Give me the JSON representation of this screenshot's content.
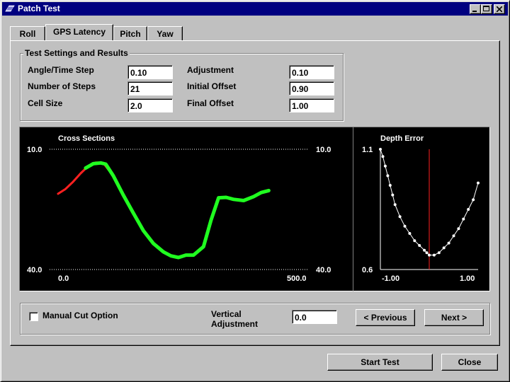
{
  "window": {
    "title": "Patch Test"
  },
  "tabs": [
    {
      "label": "Roll"
    },
    {
      "label": "GPS Latency"
    },
    {
      "label": "Pitch"
    },
    {
      "label": "Yaw"
    }
  ],
  "active_tab": "GPS Latency",
  "settings": {
    "group_title": "Test Settings and Results",
    "angle_time_step": {
      "label": "Angle/Time Step",
      "value": "0.10"
    },
    "number_of_steps": {
      "label": "Number of Steps",
      "value": "21"
    },
    "cell_size": {
      "label": "Cell Size",
      "value": "2.0"
    },
    "adjustment": {
      "label": "Adjustment",
      "value": "0.10"
    },
    "initial_offset": {
      "label": "Initial Offset",
      "value": "0.90"
    },
    "final_offset": {
      "label": "Final Offset",
      "value": "1.00"
    }
  },
  "cross_sections": {
    "title": "Cross Sections",
    "y_top_left": "10.0",
    "y_top_right": "10.0",
    "y_bottom_left": "40.0",
    "y_bottom_right": "40.0",
    "x_left": "0.0",
    "x_right": "500.0"
  },
  "depth_error": {
    "title": "Depth Error",
    "y_max": "1.1",
    "y_min": "0.6",
    "x_min": "-1.00",
    "x_max": "1.00"
  },
  "bottom_controls": {
    "manual_cut_label": "Manual Cut Option",
    "manual_cut_checked": false,
    "vertical_adjustment_label_1": "Vertical",
    "vertical_adjustment_label_2": "Adjustment",
    "vertical_adjustment_value": "0.0",
    "previous_label": "< Previous",
    "next_label": "Next >"
  },
  "footer": {
    "start_test_label": "Start Test",
    "close_label": "Close"
  },
  "chart_data": [
    {
      "type": "line",
      "title": "Cross Sections",
      "xlim": [
        0,
        500
      ],
      "ylim": [
        10,
        40
      ],
      "y_inverted": true,
      "series": [
        {
          "color": "#ff2020",
          "x": [
            0,
            15,
            30,
            45,
            60,
            75,
            90,
            110,
            130,
            150,
            170,
            190,
            210,
            225,
            240,
            255,
            270,
            290,
            305,
            320,
            335,
            350,
            370,
            390,
            405,
            420
          ],
          "y": [
            21.1,
            19.9,
            18.1,
            16.0,
            14.2,
            13.3,
            13.4,
            16.6,
            21.4,
            25.9,
            30.3,
            33.5,
            35.6,
            36.6,
            37.0,
            36.4,
            36.4,
            34.3,
            27.7,
            22.1,
            22.0,
            22.5,
            22.8,
            21.8,
            20.8,
            20.3
          ]
        },
        {
          "color": "#20ff20",
          "x": [
            55,
            70,
            85,
            95,
            110,
            130,
            150,
            170,
            190,
            210,
            225,
            240,
            255,
            270,
            290,
            305,
            320,
            335,
            350,
            370,
            390,
            405,
            420
          ],
          "y": [
            14.7,
            13.6,
            13.4,
            13.7,
            16.6,
            21.4,
            25.9,
            30.3,
            33.5,
            35.6,
            36.6,
            37.0,
            36.4,
            36.4,
            34.3,
            27.7,
            22.1,
            22.0,
            22.5,
            22.8,
            21.8,
            20.8,
            20.3
          ]
        }
      ]
    },
    {
      "type": "line",
      "title": "Depth Error",
      "xlim": [
        -1.0,
        1.0
      ],
      "ylim": [
        0.6,
        1.1
      ],
      "x": [
        -1.0,
        -0.95,
        -0.9,
        -0.85,
        -0.8,
        -0.75,
        -0.7,
        -0.6,
        -0.5,
        -0.4,
        -0.3,
        -0.2,
        -0.1,
        -0.05,
        0.0,
        0.1,
        0.2,
        0.3,
        0.4,
        0.5,
        0.6,
        0.7,
        0.8,
        0.9,
        1.0
      ],
      "y": [
        1.1,
        1.07,
        1.03,
        0.99,
        0.95,
        0.91,
        0.87,
        0.82,
        0.78,
        0.75,
        0.72,
        0.7,
        0.68,
        0.67,
        0.66,
        0.66,
        0.67,
        0.69,
        0.71,
        0.74,
        0.77,
        0.81,
        0.85,
        0.89,
        0.96
      ],
      "marker_line_x": 0.0
    }
  ]
}
